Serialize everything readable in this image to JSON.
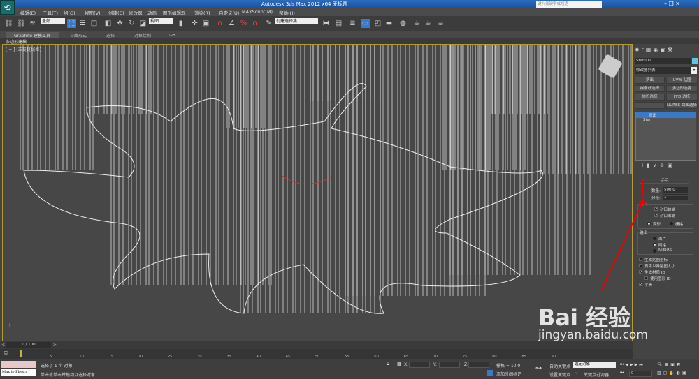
{
  "titlebar": {
    "app_title": "Autodesk 3ds Max  2012 x64     无标题",
    "search_placeholder": "键入关键字或短语"
  },
  "menu": [
    "编辑(E)",
    "工具(T)",
    "组(G)",
    "视图(V)",
    "创建(C)",
    "修改器",
    "动画",
    "图形编辑器",
    "渲染(R)",
    "自定义(U)",
    "MAXScript(M)",
    "帮助(H)"
  ],
  "toolbar": {
    "selection_filter": "全部",
    "reference_coord": "视图",
    "named_selection": "创建选择集"
  },
  "ribbon": {
    "tabs": [
      "Graphite 建模工具",
      "自由形式",
      "选择",
      "对象绘制"
    ],
    "panel_label": "多边形建模"
  },
  "viewport": {
    "label": "[ + ] [正交] [线框]"
  },
  "command_panel": {
    "object_name": "Star001",
    "object_color": "#5cc8e0",
    "modifier_list": "修改器列表",
    "modifier_buttons": [
      "挤出",
      "UVW 贴图",
      "样条线选择",
      "多边形选择",
      "体积选择",
      "FFD 选择",
      "",
      "NURBS 曲面选择"
    ],
    "stack": [
      "挤出",
      "Star"
    ],
    "rollout_title": "参数",
    "amount_label": "数量:",
    "amount_value": "500.0",
    "segments_label": "分段:",
    "segments_value": "1",
    "capping_title": "封口",
    "cap_start": "封口始端",
    "cap_end": "封口末端",
    "morph": "变形",
    "grid": "栅格",
    "output_title": "输出",
    "patch": "面片",
    "mesh": "网格",
    "nurbs": "NURBS",
    "gen_mapping": "生成贴图坐标",
    "real_world": "真实世界贴图大小",
    "gen_matid": "生成材质 ID",
    "use_shape_id": "使用图形 ID",
    "smooth": "平滑"
  },
  "timeline": {
    "frame": "0 / 100",
    "ticks": [
      "0",
      "5",
      "10",
      "15",
      "20",
      "25",
      "30",
      "35",
      "40",
      "45",
      "50",
      "55",
      "60",
      "65",
      "70",
      "75",
      "80",
      "85",
      "90"
    ]
  },
  "status": {
    "maxscript": "Max to Physcs (",
    "selected": "选择了 1 个 对象",
    "prompt": "单击或单击并拖动以选择对象",
    "x_label": "X:",
    "y_label": "Y:",
    "z_label": "Z:",
    "grid": "栅格 = 10.0",
    "add_time_tag": "添加时间标记",
    "auto_key": "自动关键点",
    "set_key": "设置关键点",
    "key_target": "选定对象",
    "key_filters": "关键点过滤器...",
    "frame_value": "0"
  },
  "watermark": {
    "text": "Bai 经验",
    "url": "jingyan.baidu.com"
  }
}
